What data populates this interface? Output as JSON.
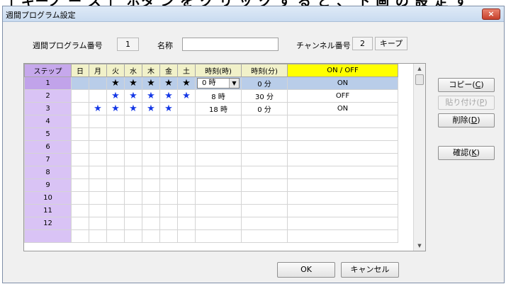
{
  "top_cut_text": "［ キーノ ー ス ］ ボタ ン を ク リ ッ ク す る と 、 下 画 の 設 定 す",
  "window": {
    "title": "週間プログラム設定",
    "close_label": "×"
  },
  "header": {
    "program_no_label": "週間プログラム番号",
    "program_no_value": "1",
    "name_label": "名称",
    "name_value": "",
    "channel_label": "チャンネル番号",
    "channel_value": "2",
    "channel_kind": "キープ"
  },
  "grid": {
    "columns": [
      "ステップ",
      "日",
      "月",
      "火",
      "水",
      "木",
      "金",
      "土",
      "時刻(時)",
      "時刻(分)",
      "ON / OFF"
    ],
    "star_glyph": "★",
    "rows": [
      {
        "step": "1",
        "days": [
          "",
          "",
          "★",
          "★",
          "★",
          "★",
          "★"
        ],
        "hour": "0 時",
        "minute": "0 分",
        "onoff": "ON",
        "selected": true
      },
      {
        "step": "2",
        "days": [
          "",
          "",
          "★",
          "★",
          "★",
          "★",
          "★"
        ],
        "hour": "8 時",
        "minute": "30 分",
        "onoff": "OFF"
      },
      {
        "step": "3",
        "days": [
          "",
          "★",
          "★",
          "★",
          "★",
          "★",
          ""
        ],
        "hour": "18 時",
        "minute": "0 分",
        "onoff": "ON"
      },
      {
        "step": "4",
        "days": [
          "",
          "",
          "",
          "",
          "",
          "",
          ""
        ],
        "hour": "",
        "minute": "",
        "onoff": ""
      },
      {
        "step": "5",
        "days": [
          "",
          "",
          "",
          "",
          "",
          "",
          ""
        ],
        "hour": "",
        "minute": "",
        "onoff": ""
      },
      {
        "step": "6",
        "days": [
          "",
          "",
          "",
          "",
          "",
          "",
          ""
        ],
        "hour": "",
        "minute": "",
        "onoff": ""
      },
      {
        "step": "7",
        "days": [
          "",
          "",
          "",
          "",
          "",
          "",
          ""
        ],
        "hour": "",
        "minute": "",
        "onoff": ""
      },
      {
        "step": "8",
        "days": [
          "",
          "",
          "",
          "",
          "",
          "",
          ""
        ],
        "hour": "",
        "minute": "",
        "onoff": ""
      },
      {
        "step": "9",
        "days": [
          "",
          "",
          "",
          "",
          "",
          "",
          ""
        ],
        "hour": "",
        "minute": "",
        "onoff": ""
      },
      {
        "step": "10",
        "days": [
          "",
          "",
          "",
          "",
          "",
          "",
          ""
        ],
        "hour": "",
        "minute": "",
        "onoff": ""
      },
      {
        "step": "11",
        "days": [
          "",
          "",
          "",
          "",
          "",
          "",
          ""
        ],
        "hour": "",
        "minute": "",
        "onoff": ""
      },
      {
        "step": "12",
        "days": [
          "",
          "",
          "",
          "",
          "",
          "",
          ""
        ],
        "hour": "",
        "minute": "",
        "onoff": ""
      },
      {
        "step": "",
        "days": [
          "",
          "",
          "",
          "",
          "",
          "",
          ""
        ],
        "hour": "",
        "minute": "",
        "onoff": ""
      }
    ]
  },
  "buttons": {
    "copy": {
      "label": "コピー(",
      "key": "C",
      "end": ")"
    },
    "paste": {
      "label": "貼り付け(",
      "key": "P",
      "end": ")"
    },
    "delete": {
      "label": "削除(",
      "key": "D",
      "end": ")"
    },
    "confirm": {
      "label": "確認(",
      "key": "K",
      "end": ")"
    },
    "ok": "OK",
    "cancel": "キャンセル"
  },
  "colors": {
    "step_header": "#c6a8ec",
    "step_cell": "#d9c3f5",
    "onoff_header": "#ffff00",
    "selected_row": "#b9cde9",
    "star": "#1538e6"
  }
}
